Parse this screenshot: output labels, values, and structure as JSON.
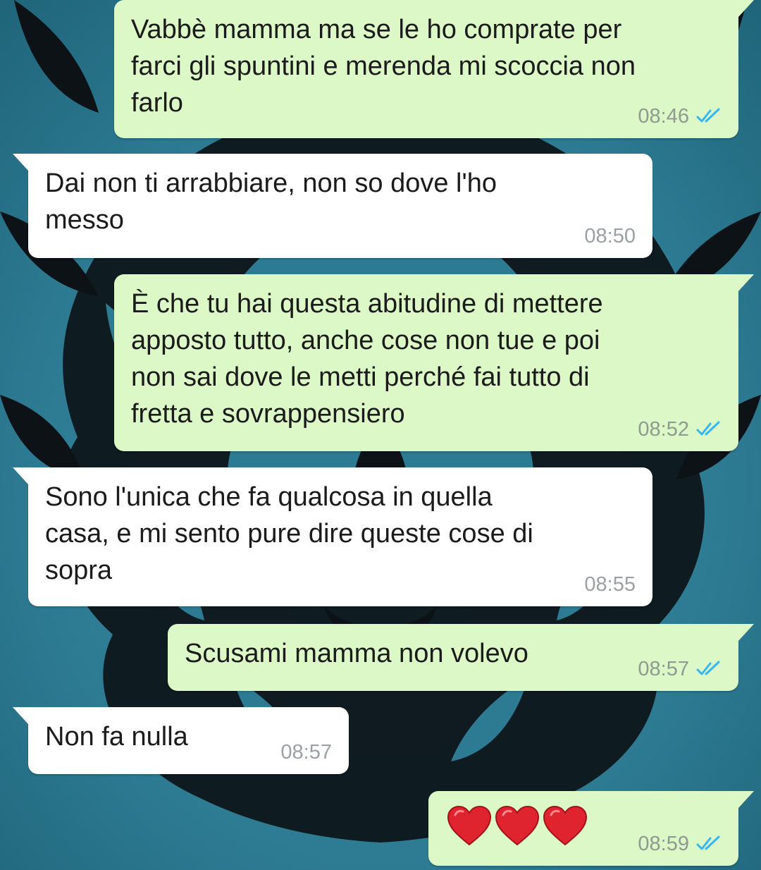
{
  "conversation": {
    "messages": [
      {
        "text": "Vabbè mamma ma se le ho comprate per\nfarci gli spuntini e merenda mi scoccia non\nfarlo",
        "time": "08:46"
      },
      {
        "text": "Dai non ti arrabbiare, non so dove l'ho\nmesso",
        "time": "08:50"
      },
      {
        "text": "È che tu hai questa abitudine di mettere\napposto tutto, anche cose non tue e poi\nnon sai dove le metti perché fai tutto di\nfretta e sovrappensiero",
        "time": "08:52"
      },
      {
        "text": "Sono l'unica che fa qualcosa in quella\ncasa, e mi sento pure dire queste cose di\nsopra",
        "time": "08:55"
      },
      {
        "text": "Scusami mamma non volevo",
        "time": "08:57"
      },
      {
        "text": "Non fa nulla",
        "time": "08:57"
      },
      {
        "text": "",
        "emoji": [
          "red-heart",
          "red-heart",
          "red-heart"
        ],
        "time": "08:59"
      }
    ]
  },
  "colors": {
    "outgoing_bubble": "#dcf8c6",
    "incoming_bubble": "#ffffff",
    "read_ticks": "#34b7f1",
    "wallpaper": "#2f7f98",
    "wallpaper_pattern": "#0c1216"
  },
  "icons": {
    "read_receipt": "double-check-icon",
    "heart": "red-heart-icon"
  }
}
